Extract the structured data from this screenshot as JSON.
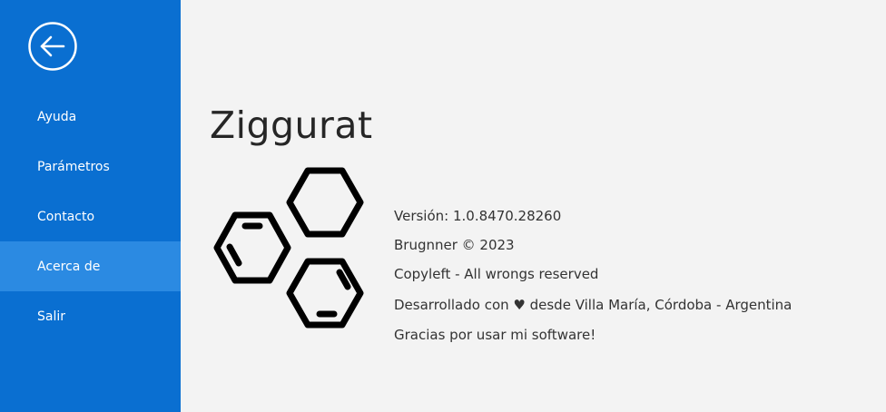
{
  "sidebar": {
    "back_icon": "arrow-left-circle-icon",
    "items": [
      {
        "label": "Ayuda",
        "active": false
      },
      {
        "label": "Parámetros",
        "active": false
      },
      {
        "label": "Contacto",
        "active": false
      },
      {
        "label": "Acerca de",
        "active": true
      },
      {
        "label": "Salir",
        "active": false
      }
    ]
  },
  "about": {
    "app_name": "Ziggurat",
    "logo_icon": "hexagon-molecule-logo",
    "lines": [
      "Versión: 1.0.8470.28260",
      "Brugnner © 2023",
      "Copyleft - All wrongs reserved",
      "Desarrollado con ♥ desde Villa María, Córdoba - Argentina",
      "Gracias por usar mi software!"
    ]
  },
  "colors": {
    "sidebar_bg": "#0a6fd1",
    "sidebar_active_bg": "#2b8ae2",
    "content_bg": "#f3f3f3",
    "text": "#333333"
  }
}
